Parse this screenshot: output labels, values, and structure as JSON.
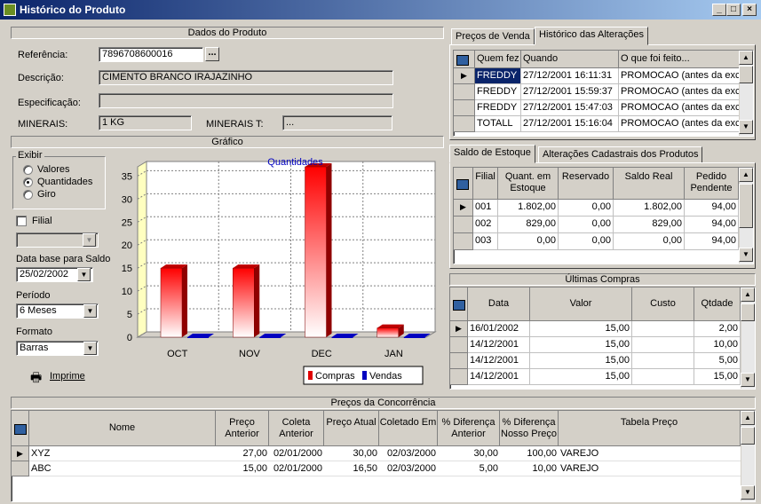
{
  "window": {
    "title": "Histórico do Produto",
    "min": "_",
    "max": "□",
    "close": "×"
  },
  "dados": {
    "header": "Dados do Produto",
    "ref_label": "Referência:",
    "ref_value": "7896708600016",
    "dots": "...",
    "desc_label": "Descrição:",
    "desc_value": "CIMENTO BRANCO IRAJAZINHO",
    "espec_label": "Especificação:",
    "espec_value": "",
    "min_label": "MINERAIS:",
    "min_value": "1 KG",
    "mint_label": "MINERAIS T:",
    "mint_value": "..."
  },
  "grafico": {
    "header": "Gráfico",
    "exibir": "Exibir",
    "opt_valores": "Valores",
    "opt_quantidades": "Quantidades",
    "opt_giro": "Giro",
    "filial_label": "Filial",
    "data_base_label": "Data base para Saldo",
    "data_base_value": "25/02/2002",
    "periodo_label": "Período",
    "periodo_value": "6 Meses",
    "formato_label": "Formato",
    "formato_value": "Barras",
    "imprime": "Imprime"
  },
  "chart_data": {
    "type": "bar",
    "title": "Quantidades",
    "categories": [
      "OCT",
      "NOV",
      "DEC",
      "JAN"
    ],
    "series": [
      {
        "name": "Compras",
        "values": [
          15,
          15,
          37,
          2
        ],
        "color": "#e00000"
      },
      {
        "name": "Vendas",
        "values": [
          0,
          0,
          0,
          0
        ],
        "color": "#0000c0"
      }
    ],
    "ylim": [
      0,
      37
    ],
    "yticks": [
      0,
      5,
      10,
      15,
      20,
      25,
      30,
      35
    ],
    "grid": true,
    "legend": "bottom-right"
  },
  "tabs_top": {
    "tab1": "Preços de Venda",
    "tab2": "Histórico das Alterações",
    "columns": [
      "Quem fez",
      "Quando",
      "O que foi feito..."
    ],
    "rows": [
      [
        "FREDDY",
        "27/12/2001 16:11:31",
        "PROMOCAO (antes da exc"
      ],
      [
        "FREDDY",
        "27/12/2001 15:59:37",
        "PROMOCAO (antes da exc"
      ],
      [
        "FREDDY",
        "27/12/2001 15:47:03",
        "PROMOCAO (antes da exc"
      ],
      [
        "TOTALL",
        "27/12/2001 15:16:04",
        "PROMOCAO (antes da exc"
      ]
    ]
  },
  "tabs_mid": {
    "tab1": "Saldo de Estoque",
    "tab2": "Alterações Cadastrais dos Produtos",
    "columns": [
      "Filial",
      "Quant. em Estoque",
      "Reservado",
      "Saldo Real",
      "Pedido Pendente"
    ],
    "rows": [
      [
        "001",
        "1.802,00",
        "0,00",
        "1.802,00",
        "94,00"
      ],
      [
        "002",
        "829,00",
        "0,00",
        "829,00",
        "94,00"
      ],
      [
        "003",
        "0,00",
        "0,00",
        "0,00",
        "94,00"
      ]
    ]
  },
  "ultimas": {
    "header": "Últimas Compras",
    "columns": [
      "Data",
      "Valor",
      "Custo",
      "Qtdade"
    ],
    "rows": [
      [
        "16/01/2002",
        "15,00",
        "",
        "2,00"
      ],
      [
        "14/12/2001",
        "15,00",
        "",
        "10,00"
      ],
      [
        "14/12/2001",
        "15,00",
        "",
        "5,00"
      ],
      [
        "14/12/2001",
        "15,00",
        "",
        "15,00"
      ]
    ]
  },
  "concorrencia": {
    "header": "Preços da Concorrência",
    "columns": [
      "Nome",
      "Preço Anterior",
      "Coleta Anterior",
      "Preço Atual",
      "Coletado Em",
      "% Diferença Anterior",
      "% Diferença Nosso Preço",
      "Tabela Preço"
    ],
    "rows": [
      [
        "XYZ",
        "27,00",
        "02/01/2000",
        "30,00",
        "02/03/2000",
        "30,00",
        "100,00",
        "VAREJO"
      ],
      [
        "ABC",
        "15,00",
        "02/01/2000",
        "16,50",
        "02/03/2000",
        "5,00",
        "10,00",
        "VAREJO"
      ]
    ]
  }
}
